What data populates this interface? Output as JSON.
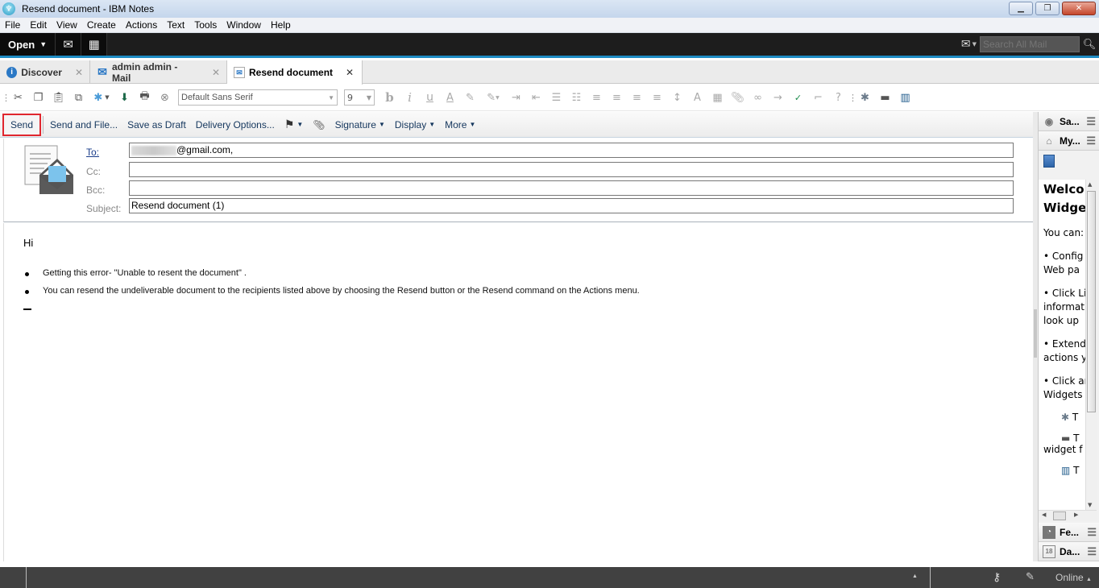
{
  "window": {
    "title": "Resend document  - IBM Notes",
    "controls": {
      "minimize": "minimize",
      "restore": "restore",
      "close": "close"
    }
  },
  "menubar": [
    "File",
    "Edit",
    "View",
    "Create",
    "Actions",
    "Text",
    "Tools",
    "Window",
    "Help"
  ],
  "quickbar": {
    "open_label": "Open",
    "search_placeholder": "Search All Mail"
  },
  "tabs": [
    {
      "label": "Discover",
      "icon": "info-icon",
      "active": false
    },
    {
      "label": "admin admin - Mail",
      "icon": "mail-icon",
      "active": false
    },
    {
      "label": "Resend document",
      "icon": "memo-icon",
      "active": true
    }
  ],
  "toolbar": {
    "font_name": "Default Sans Serif",
    "font_size": "9"
  },
  "actions": {
    "send": "Send",
    "send_and_file": "Send and File...",
    "save_as_draft": "Save as Draft",
    "delivery_options": "Delivery Options...",
    "signature": "Signature",
    "display": "Display",
    "more": "More"
  },
  "header": {
    "to_label": "To:",
    "to_value": "@gmail.com,",
    "cc_label": "Cc:",
    "cc_value": "",
    "bcc_label": "Bcc:",
    "bcc_value": "",
    "subject_label": "Subject:",
    "subject_value": "Resend document (1)"
  },
  "body": {
    "greeting": "Hi",
    "bullets": [
      "Getting this error- \"Unable to resent the document\" .",
      "You can resend the undeliverable document to the recipients listed above by choosing the Resend button or the Resend command on the Actions menu."
    ]
  },
  "sidebar": {
    "panels_top": [
      {
        "label": "Sa...",
        "icon": "sametime-icon"
      },
      {
        "label": "My...",
        "icon": "toolbox-icon"
      }
    ],
    "welcome_title_1": "Welco",
    "welcome_title_2": "Widge",
    "lines": [
      "You can:",
      [
        "• Config",
        "Web pa"
      ],
      [
        "• Click Li",
        "informat",
        "look up"
      ],
      [
        "• Extend",
        "actions y"
      ],
      [
        "• Click ar",
        "Widgets"
      ]
    ],
    "sub_items": [
      {
        "icon": "widget-icon",
        "text": "T"
      },
      {
        "icon": "toolbox-icon",
        "text": "T",
        "extra": "widget f"
      },
      {
        "icon": "sidebar-icon",
        "text": "T"
      }
    ],
    "panels_bottom": [
      {
        "label": "Fe...",
        "icon": "feed-icon"
      },
      {
        "label": "Da...",
        "icon": "calendar-icon"
      }
    ]
  },
  "statusbar": {
    "online_label": "Online"
  }
}
